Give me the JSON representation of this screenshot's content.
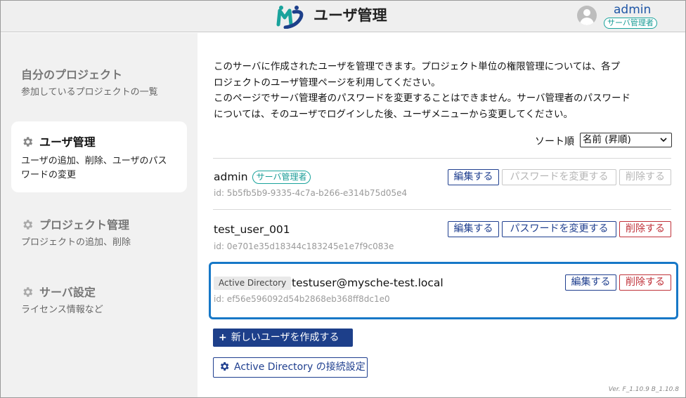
{
  "header": {
    "title": "ユーザ管理",
    "user": "admin",
    "user_role": "サーバ管理者"
  },
  "sidebar": {
    "items": [
      {
        "title": "自分のプロジェクト",
        "desc": "参加しているプロジェクトの一覧",
        "active": false
      },
      {
        "title": "ユーザ管理",
        "desc_line1": "ユーザの追加、削除、ユーザのパス",
        "desc_line2": "ワードの変更",
        "active": true
      },
      {
        "title": "プロジェクト管理",
        "desc": "プロジェクトの追加、削除",
        "active": false
      },
      {
        "title": "サーバ設定",
        "desc": "ライセンス情報など",
        "active": false
      }
    ]
  },
  "main": {
    "description": [
      "このサーバに作成されたユーザを管理できます。プロジェクト単位の権限管理については、各プ",
      "ロジェクトのユーザ管理ページを利用してください。",
      "このページでサーバ管理者のパスワードを変更することはできません。サーバ管理者のパスワード",
      "については、そのユーザでログインした後、ユーザメニューから変更してください。"
    ],
    "sort_label": "ソート順",
    "sort_value": "名前 (昇順)",
    "users": [
      {
        "name": "admin",
        "badge": "サーバ管理者",
        "id": "id: 5b5fb5b9-9335-4c7a-b266-e314b75d05e4",
        "edit": "編集する",
        "password": "パスワードを変更する",
        "delete": "削除する"
      },
      {
        "name": "test_user_001",
        "id": "id: 0e701e35d18344c183245e1e7f9c083e",
        "edit": "編集する",
        "password": "パスワードを変更する",
        "delete": "削除する"
      },
      {
        "name": "testuser@mysche-test.local",
        "tag": "Active Directory",
        "id": "id: ef56e596092d54b2868eb368ff8dc1e0",
        "edit": "編集する",
        "delete": "削除する"
      }
    ],
    "create_button": "新しいユーザを作成する",
    "create_icon": "+",
    "ad_button": "Active Directory の接続設定",
    "version": "Ver. F_1.10.9  B_1.10.8"
  },
  "colors": {
    "primary": "#1d3f8a",
    "accent_teal": "#1aa39c",
    "danger": "#c0323a",
    "highlight": "#1778c7"
  }
}
